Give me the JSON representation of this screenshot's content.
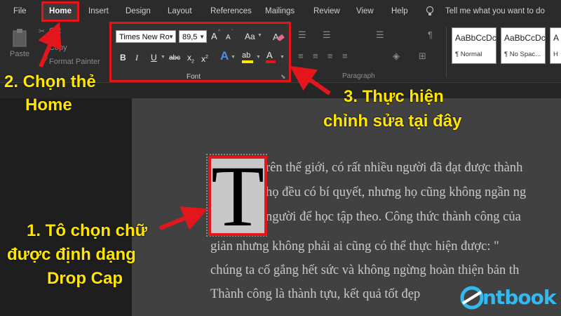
{
  "menu": {
    "tabs": [
      "File",
      "Home",
      "Insert",
      "Design",
      "Layout",
      "References",
      "Mailings",
      "Review",
      "View",
      "Help"
    ],
    "tell_me": "Tell me what you want to do"
  },
  "clipboard": {
    "paste": "Paste",
    "cut": "Cut",
    "copy": "Copy",
    "format_painter": "Format Painter"
  },
  "font_group": {
    "font_name": "Times New Ro",
    "font_size": "89,5",
    "label": "Font",
    "grow": "A",
    "shrink": "A",
    "change_case": "Aa",
    "bold": "B",
    "italic": "I",
    "underline": "U",
    "strikethrough": "abc",
    "subscript": "x",
    "superscript": "x",
    "text_effects": "A",
    "highlight": "ab",
    "font_color": "A"
  },
  "paragraph_group": {
    "label": "Paragraph"
  },
  "styles": [
    {
      "sample": "AaBbCcDc",
      "name": "¶ Normal"
    },
    {
      "sample": "AaBbCcDc",
      "name": "¶ No Spac..."
    },
    {
      "sample": "A",
      "name": "H"
    }
  ],
  "document": {
    "drop_cap": "T",
    "lines": [
      "rên thế giới, có rất nhiều người đã đạt được thành",
      "họ đều có bí quyết, nhưng họ cũng không ngần ng",
      "người để học tập theo. Công thức thành công của",
      "giản nhưng không phải ai cũng có thể thực hiện được: \"",
      "chúng ta cố gắng hết sức và không ngừng hoàn thiện bản th",
      "Thành công là thành tựu, kết quả tốt đẹp"
    ]
  },
  "annotations": {
    "step1": [
      "1. Tô chọn chữ",
      "được định dạng",
      "Drop Cap"
    ],
    "step2": [
      "2. Chọn thẻ",
      "Home"
    ],
    "step3": [
      "3. Thực hiện",
      "chỉnh sửa tại đây"
    ]
  },
  "brand": {
    "logo_text": "ntbook",
    "color": "#33b8f0"
  },
  "colors": {
    "highlight_red": "#e3171b",
    "annotation_yellow": "#ffe600"
  }
}
